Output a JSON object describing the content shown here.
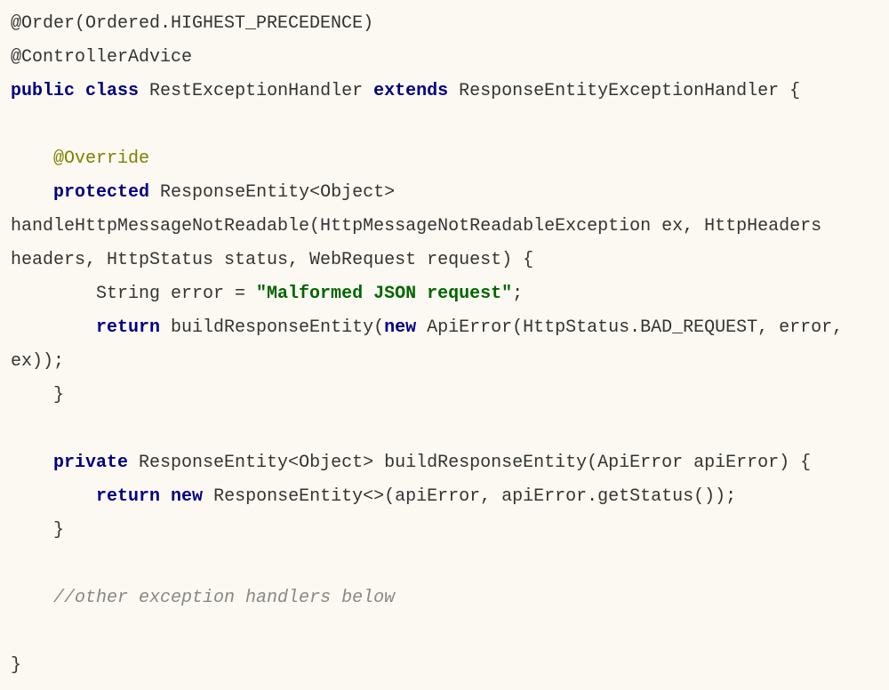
{
  "code": {
    "line1": "@Order(Ordered.HIGHEST_PRECEDENCE)",
    "line2": "@ControllerAdvice",
    "kw_public": "public",
    "kw_class": "class",
    "class_name": " RestExceptionHandler ",
    "kw_extends": "extends",
    "extends_rest": " ResponseEntityExceptionHandler {",
    "annotation_override": "@Override",
    "kw_protected": "protected",
    "method1_sig_part1": " ResponseEntity<Object> handleHttpMessageNotReadable(HttpMessageNotReadableException ex, HttpHeaders headers, HttpStatus status, WebRequest request) {",
    "string_decl": "        String error = ",
    "string_val": "\"Malformed JSON request\"",
    "semicolon": ";",
    "kw_return": "return",
    "return1_rest": " buildResponseEntity(",
    "kw_new": "new",
    "new1_rest": " ApiError(HttpStatus.BAD_REQUEST, error, ex));",
    "close_brace_m1": "    }",
    "kw_private": "private",
    "method2_sig": " ResponseEntity<Object> buildResponseEntity(ApiError apiError) {",
    "return2_prefix": "        ",
    "return2_mid": " ",
    "return2_rest": " ResponseEntity<>(apiError, apiError.getStatus());",
    "close_brace_m2": "    }",
    "comment_text": "//other exception handlers below",
    "close_brace_class": "}"
  }
}
